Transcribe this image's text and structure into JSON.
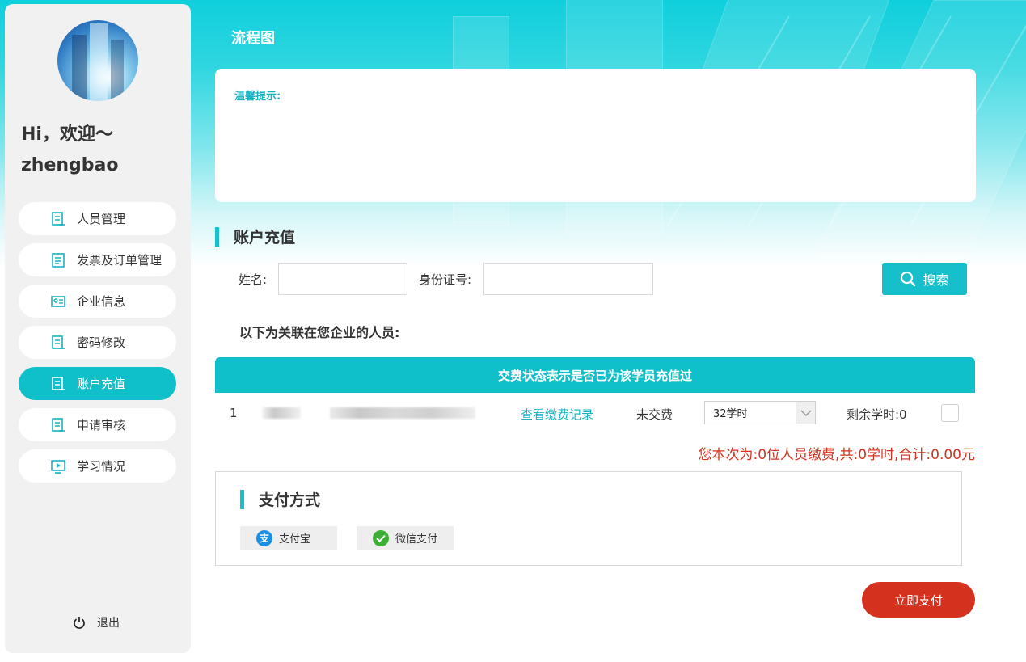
{
  "sidebar": {
    "greeting_line1": "Hi，欢迎～",
    "greeting_line2": "zhengbao",
    "items": [
      {
        "label": "人员管理"
      },
      {
        "label": "发票及订单管理"
      },
      {
        "label": "企业信息"
      },
      {
        "label": "密码修改"
      },
      {
        "label": "账户充值",
        "active": true
      },
      {
        "label": "申请审核"
      },
      {
        "label": "学习情况"
      }
    ],
    "logout_label": "退出"
  },
  "header": {
    "title": "流程图"
  },
  "tip": {
    "label": "温馨提示:"
  },
  "recharge": {
    "section_title": "账户充值",
    "name_label": "姓名:",
    "name_value": "",
    "id_label": "身份证号:",
    "id_value": "",
    "search_label": "搜索",
    "assoc_title": "以下为关联在您企业的人员:",
    "table_header": "交费状态表示是否已为该学员充值过",
    "rows": [
      {
        "index": "1",
        "view_link": "查看缴费记录",
        "status": "未交费",
        "hours_option": "32学时",
        "remaining": "剩余学时:0"
      }
    ],
    "summary": "您本次为:0位人员缴费,共:0学时,合计:0.00元"
  },
  "payment": {
    "title": "支付方式",
    "options": [
      {
        "label": "支付宝",
        "color": "#1a8fe3"
      },
      {
        "label": "微信支付",
        "color": "#3cb034"
      }
    ],
    "pay_now_label": "立即支付"
  },
  "colors": {
    "accent": "#0fbfc9",
    "danger": "#d4321f"
  }
}
